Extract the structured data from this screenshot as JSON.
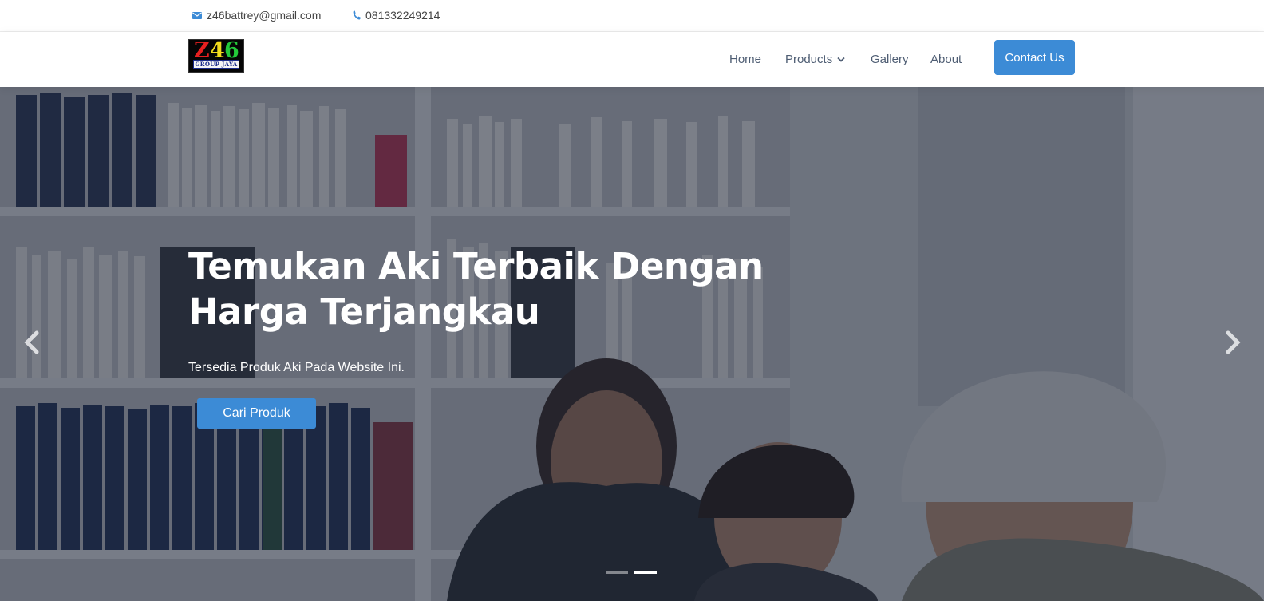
{
  "topbar": {
    "email": "z46battrey@gmail.com",
    "phone": "081332249214"
  },
  "header": {
    "logo": {
      "text": "Z46",
      "tagline": "GROUP JAYA"
    },
    "nav": {
      "home": "Home",
      "products": "Products",
      "gallery": "Gallery",
      "about": "About"
    },
    "contact_button": "Contact Us"
  },
  "hero": {
    "title": "Temukan Aki Terbaik Dengan Harga Terjangkau",
    "subtitle": "Tersedia Produk Aki Pada Website Ini.",
    "cta": "Cari Produk",
    "slides_total": 2,
    "active_slide": 2
  },
  "colors": {
    "accent": "#3c8bd6",
    "nav_text": "#4e5d73",
    "overlay": "#161e2d"
  },
  "icons": {
    "email": "envelope-icon",
    "phone": "phone-icon",
    "dropdown": "chevron-down-icon",
    "prev": "chevron-left-icon",
    "next": "chevron-right-icon"
  }
}
